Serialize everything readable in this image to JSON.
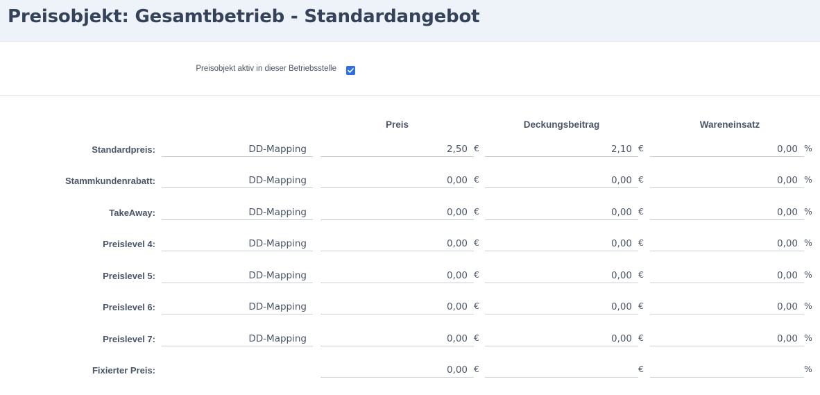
{
  "header": {
    "title": "Preisobjekt: Gesamtbetrieb - Standardangebot"
  },
  "active": {
    "label": "Preisobjekt aktiv in dieser Betriebsstelle",
    "checked": true
  },
  "columns": {
    "preis": "Preis",
    "deckungsbeitrag": "Deckungsbeitrag",
    "wareneinsatz": "Wareneinsatz"
  },
  "units": {
    "preis": "€",
    "deckungsbeitrag": "€",
    "wareneinsatz": "%"
  },
  "rows": [
    {
      "label": "Standardpreis:",
      "mapping": "DD-Mapping",
      "preis": "2,50",
      "deckungsbeitrag": "2,10",
      "wareneinsatz": "0,00"
    },
    {
      "label": "Stammkundenrabatt:",
      "mapping": "DD-Mapping",
      "preis": "0,00",
      "deckungsbeitrag": "0,00",
      "wareneinsatz": "0,00"
    },
    {
      "label": "TakeAway:",
      "mapping": "DD-Mapping",
      "preis": "0,00",
      "deckungsbeitrag": "0,00",
      "wareneinsatz": "0,00"
    },
    {
      "label": "Preislevel 4:",
      "mapping": "DD-Mapping",
      "preis": "0,00",
      "deckungsbeitrag": "0,00",
      "wareneinsatz": "0,00"
    },
    {
      "label": "Preislevel 5:",
      "mapping": "DD-Mapping",
      "preis": "0,00",
      "deckungsbeitrag": "0,00",
      "wareneinsatz": "0,00"
    },
    {
      "label": "Preislevel 6:",
      "mapping": "DD-Mapping",
      "preis": "0,00",
      "deckungsbeitrag": "0,00",
      "wareneinsatz": "0,00"
    },
    {
      "label": "Preislevel 7:",
      "mapping": "DD-Mapping",
      "preis": "0,00",
      "deckungsbeitrag": "0,00",
      "wareneinsatz": "0,00"
    },
    {
      "label": "Fixierter Preis:",
      "mapping": "",
      "preis": "0,00",
      "deckungsbeitrag": "",
      "wareneinsatz": ""
    }
  ],
  "colors": {
    "header_bg": "#eef3fa",
    "checkbox": "#2f6fe0",
    "title": "#34425a"
  }
}
